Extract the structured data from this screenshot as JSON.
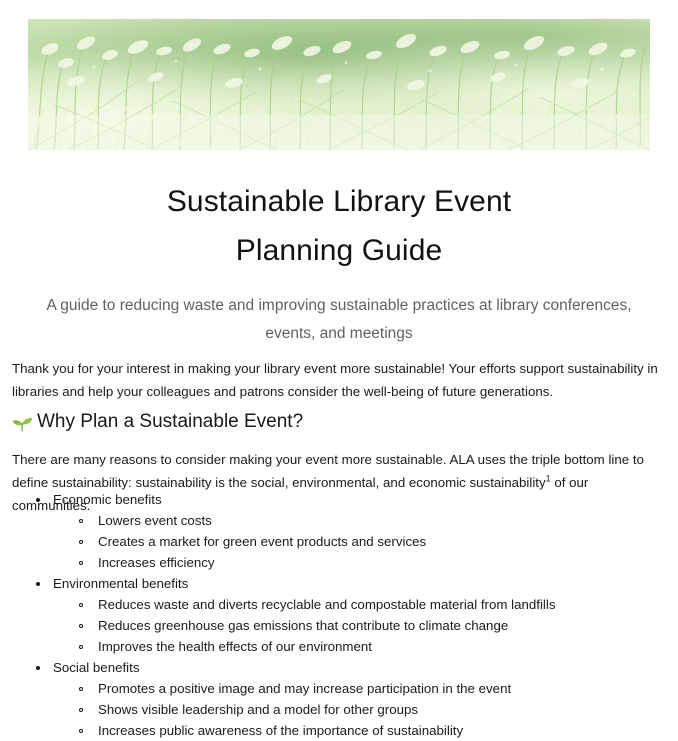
{
  "document": {
    "title_line1": "Sustainable Library Event",
    "title_line2": "Planning Guide",
    "subtitle": "A guide to reducing waste and improving sustainable practices at library conferences, events, and meetings",
    "intro_paragraph": "Thank you for your interest in making your library event more sustainable! Your efforts support sustainability in libraries and help your colleagues and patrons consider the well-being of future generations.",
    "header_image_alt": "grass-meadow-banner-photo"
  },
  "section": {
    "heading": "Why Plan a Sustainable Event?",
    "heading_icon": "seedling-icon",
    "paragraph_before_footnote": "There are many reasons to consider making your event more sustainable. ALA uses the triple bottom line to define sustainability: sustainability is the social, environmental, and economic sustainability",
    "footnote_marker": "1",
    "paragraph_after_footnote": " of our communities."
  },
  "benefits": [
    {
      "label": "Economic benefits",
      "children": [
        "Lowers event costs",
        "Creates a market for green event products and services",
        "Increases efficiency"
      ]
    },
    {
      "label": "Environmental benefits",
      "children": [
        "Reduces waste and diverts recyclable and compostable material from landfills",
        "Reduces greenhouse gas emissions that contribute to climate change",
        "Improves the health effects of our environment"
      ]
    },
    {
      "label": "Social benefits",
      "children": [
        "Promotes a positive image and may increase participation in the event",
        "Shows visible leadership and a model for other groups",
        "Increases public awareness of the importance of sustainability"
      ]
    }
  ],
  "colors": {
    "title_text": "#121212",
    "subtitle_text": "#5d6166",
    "body_text": "#1b1b1b",
    "page_background": "#ffffff",
    "banner_green_light": "#e8f2d8",
    "banner_green_mid": "#bcd9a2",
    "banner_green_dark": "#7fae71",
    "sprout_green": "#7ac143"
  }
}
